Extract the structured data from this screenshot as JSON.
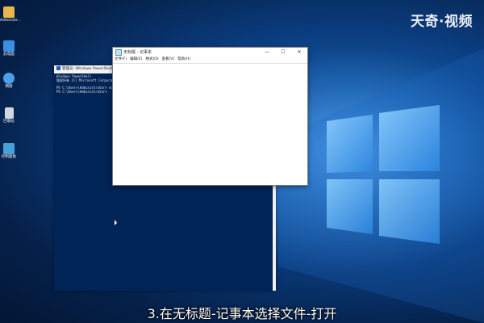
{
  "watermark": "天奇·视频",
  "subtitle": "3.在无标题-记事本选择文件-打开",
  "desktop_icons": [
    {
      "label": "Administr...",
      "icon": "folder-user-icon",
      "color": "#e8b64a"
    },
    {
      "label": "此电脑",
      "icon": "computer-icon",
      "color": "#3a8fe0"
    },
    {
      "label": "网络",
      "icon": "network-icon",
      "color": "#4aa0e8"
    },
    {
      "label": "回收站",
      "icon": "recycle-bin-icon",
      "color": "#cfd8e0"
    },
    {
      "label": "控制面板",
      "icon": "control-panel-icon",
      "color": "#48a0d8"
    }
  ],
  "powershell": {
    "title": "管理员: Windows PowerShell",
    "lines": [
      "Windows PowerShell",
      "版权所有 (C) Microsoft Corporati",
      "",
      "PS C:\\Users\\Administrator> notep",
      "PS C:\\Users\\Administrator>"
    ]
  },
  "notepad": {
    "title": "无标题 - 记事本",
    "menu": [
      "文件(F)",
      "编辑(E)",
      "格式(O)",
      "查看(V)",
      "帮助(H)"
    ],
    "controls": {
      "minimize": "—",
      "maximize": "☐",
      "close": "✕"
    },
    "content": ""
  },
  "colors": {
    "powershell_bg": "#012456",
    "desktop_dark": "#031634",
    "desktop_glow": "#2f7fd6"
  }
}
